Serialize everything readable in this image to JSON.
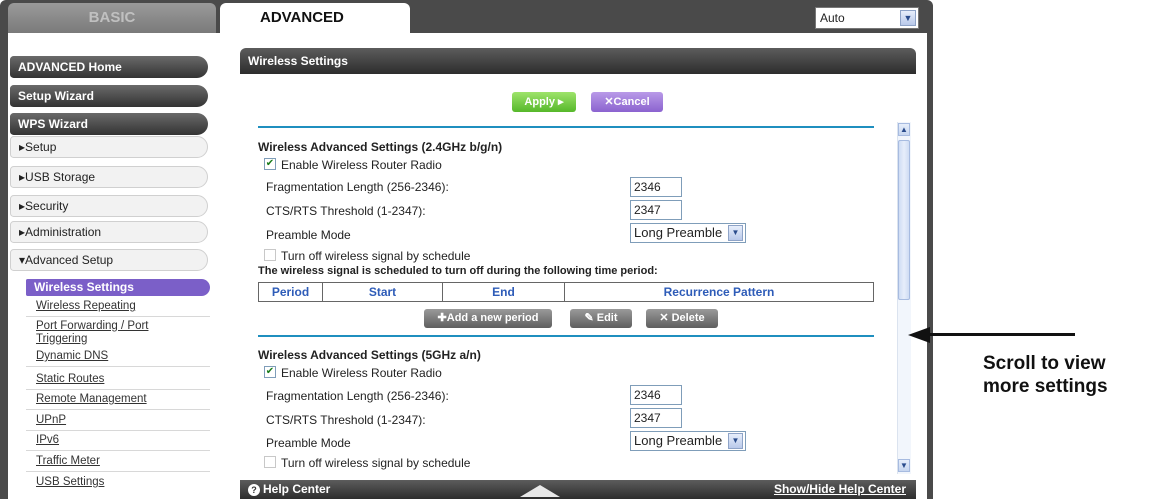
{
  "tabs": {
    "basic": "BASIC",
    "advanced": "ADVANCED"
  },
  "language_select": {
    "value": "Auto"
  },
  "sidebar": {
    "advanced_home": "ADVANCED Home",
    "setup_wizard": "Setup Wizard",
    "wps_wizard": "WPS Wizard",
    "setup": "▸Setup",
    "usb_storage": "▸USB Storage",
    "security": "▸Security",
    "administration": "▸Administration",
    "advanced_setup": "▾Advanced Setup",
    "sub": {
      "wireless_settings": "Wireless Settings",
      "wireless_repeating": "Wireless Repeating",
      "port_forwarding_1": "Port Forwarding / Port",
      "port_forwarding_2": "Triggering",
      "dynamic_dns": "Dynamic DNS",
      "static_routes": "Static Routes",
      "remote_management": "Remote Management",
      "upnp": "UPnP",
      "ipv6": "IPv6",
      "traffic_meter": "Traffic Meter",
      "usb_settings": "USB Settings"
    }
  },
  "content": {
    "title": "Wireless Settings",
    "apply": "Apply ▸",
    "cancel": "✕Cancel",
    "section_24": {
      "heading": "Wireless Advanced Settings (2.4GHz b/g/n)",
      "enable_radio": "Enable Wireless Router Radio",
      "frag_label": "Fragmentation Length (256-2346):",
      "frag_value": "2346",
      "cts_label": "CTS/RTS Threshold (1-2347):",
      "cts_value": "2347",
      "preamble_label": "Preamble Mode",
      "preamble_value": "Long Preamble",
      "schedule_off": "Turn off wireless signal by schedule",
      "schedule_note": "The wireless signal is scheduled to turn off during the following time period:",
      "table_headers": [
        "Period",
        "Start",
        "End",
        "Recurrence Pattern"
      ],
      "add_period": "✚Add a new period",
      "edit": "Edit",
      "delete": "✕ Delete"
    },
    "section_5": {
      "heading": "Wireless Advanced Settings (5GHz a/n)",
      "enable_radio": "Enable Wireless Router Radio",
      "frag_label": "Fragmentation Length (256-2346):",
      "frag_value": "2346",
      "cts_label": "CTS/RTS Threshold (1-2347):",
      "cts_value": "2347",
      "preamble_label": "Preamble Mode",
      "preamble_value": "Long Preamble",
      "schedule_off": "Turn off wireless signal by schedule"
    }
  },
  "footer": {
    "help_center": "Help Center",
    "show_hide": "Show/Hide Help Center"
  },
  "annotation": {
    "line1": "Scroll to view",
    "line2": "more settings"
  },
  "colors": {
    "accent_purple": "#7b5fc8",
    "apply_green": "#56b82a",
    "table_header_blue": "#2e5cb8",
    "divider_blue": "#1f8fbf"
  }
}
